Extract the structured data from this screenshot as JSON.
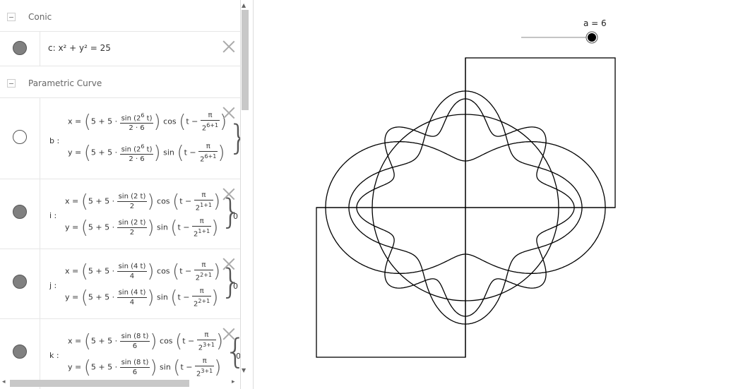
{
  "conic_group": {
    "title": "Conic"
  },
  "conic_c": {
    "formula": "c: x² + y² = 25"
  },
  "param_group": {
    "title": "Parametric Curve"
  },
  "curves": [
    {
      "name": "b :",
      "x_prefix": "x =",
      "y_prefix": "y =",
      "sin_x": "sin (2",
      "sin_exp": "6",
      "sin_t": " t)",
      "den": "2 · 6",
      "pi_den": "2",
      "pi_exp": "6+1",
      "cos": "cos",
      "sin": "sin",
      "five": "5 + 5 ·",
      "visible": false
    },
    {
      "name": "i :",
      "x_prefix": "x =",
      "y_prefix": "y =",
      "sin_x": "sin (2 t)",
      "den": "2",
      "pi_den": "2",
      "pi_exp": "1+1",
      "cos": "cos",
      "sin": "sin",
      "five": "5 + 5 ·",
      "zero": "0",
      "visible": true
    },
    {
      "name": "j :",
      "x_prefix": "x =",
      "y_prefix": "y =",
      "sin_x": "sin (4 t)",
      "den": "4",
      "pi_den": "2",
      "pi_exp": "2+1",
      "cos": "cos",
      "sin": "sin",
      "five": "5 + 5 ·",
      "zero": "0",
      "visible": true
    },
    {
      "name": "k :",
      "x_prefix": "x =",
      "y_prefix": "y =",
      "sin_x": "sin (8 t)",
      "den": "6",
      "pi_den": "2",
      "pi_exp": "3+1",
      "cos": "cos",
      "sin": "sin",
      "five": "5 + 5 ·",
      "zero": "0",
      "visible": true
    }
  ],
  "slider": {
    "label": "a = 6",
    "value": 6
  },
  "symbols": {
    "pi": "π",
    "t_minus": "t −"
  }
}
